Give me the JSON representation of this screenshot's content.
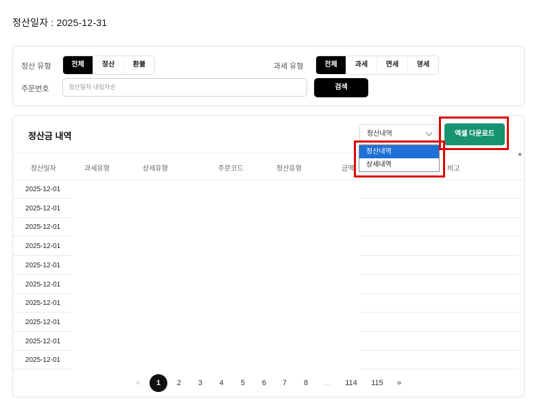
{
  "header": {
    "title": "정산일자 : 2025-12-31"
  },
  "filters": {
    "settle_type_label": "정산 유형",
    "settle_type_options": [
      "전체",
      "정산",
      "환불"
    ],
    "settle_type_selected": "전체",
    "tax_type_label": "과세 유형",
    "tax_type_options": [
      "전체",
      "과세",
      "면세",
      "영세"
    ],
    "tax_type_selected": "전체",
    "order_no_label": "주문번호",
    "order_no_placeholder": "정산일자 내림차순",
    "order_no_value": "",
    "search_label": "검색"
  },
  "list": {
    "title": "정산금 내역",
    "select_value": "정산내역",
    "select_options": [
      "정산내역",
      "상세내역"
    ],
    "excel_label": "엑셀 다운로드",
    "columns": [
      "정산일자",
      "과세유형",
      "상세유형",
      "주문코드",
      "정산유형",
      "금액",
      "비고"
    ],
    "rows": [
      "2025-12-01",
      "2025-12-01",
      "2025-12-01",
      "2025-12-01",
      "2025-12-01",
      "2025-12-01",
      "2025-12-01",
      "2025-12-01",
      "2025-12-01",
      "2025-12-01"
    ]
  },
  "pagination": {
    "prev": "«",
    "next": "»",
    "pages": [
      "1",
      "2",
      "3",
      "4",
      "5",
      "6",
      "7",
      "8",
      "...",
      "114",
      "115"
    ],
    "current": "1"
  },
  "colors": {
    "accent_green": "#17936f",
    "highlight_red": "#e00000",
    "select_blue": "#1e6fd6"
  }
}
